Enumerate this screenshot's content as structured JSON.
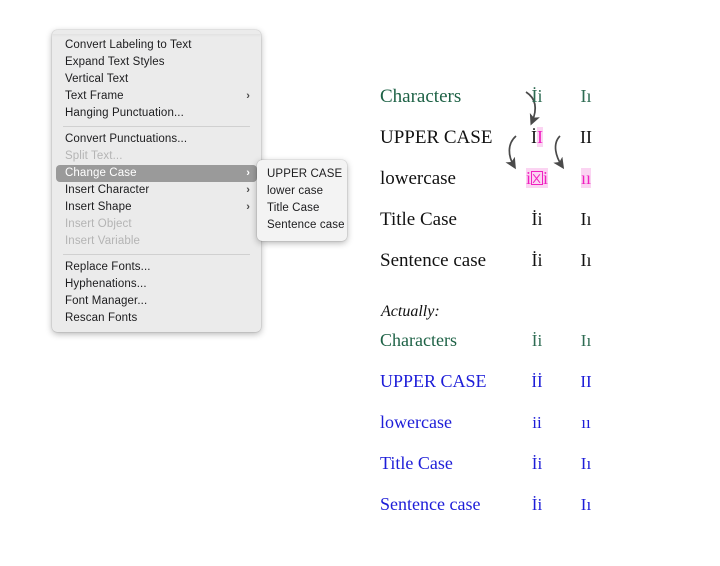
{
  "context_menu": {
    "name": "Text menu",
    "items": [
      {
        "label": "Convert Labeling to Text",
        "state": "normal",
        "submenu": false
      },
      {
        "label": "Expand Text Styles",
        "state": "normal",
        "submenu": false
      },
      {
        "label": "Vertical Text",
        "state": "normal",
        "submenu": false
      },
      {
        "label": "Text Frame",
        "state": "normal",
        "submenu": true
      },
      {
        "label": "Hanging Punctuation...",
        "state": "normal",
        "submenu": false
      },
      {
        "label": "",
        "state": "separator",
        "submenu": false
      },
      {
        "label": "Convert Punctuations...",
        "state": "normal",
        "submenu": false
      },
      {
        "label": "Split Text...",
        "state": "disabled",
        "submenu": false
      },
      {
        "label": "Change Case",
        "state": "highlighted",
        "submenu": true
      },
      {
        "label": "Insert Character",
        "state": "normal",
        "submenu": true
      },
      {
        "label": "Insert Shape",
        "state": "normal",
        "submenu": true
      },
      {
        "label": "Insert Object",
        "state": "disabled",
        "submenu": false
      },
      {
        "label": "Insert Variable",
        "state": "disabled",
        "submenu": false
      },
      {
        "label": "",
        "state": "separator",
        "submenu": false
      },
      {
        "label": "Replace Fonts...",
        "state": "normal",
        "submenu": false
      },
      {
        "label": "Hyphenations...",
        "state": "normal",
        "submenu": false
      },
      {
        "label": "Font Manager...",
        "state": "normal",
        "submenu": false
      },
      {
        "label": "Rescan Fonts",
        "state": "normal",
        "submenu": false
      }
    ],
    "submenu_arrow_glyph": "›"
  },
  "change_case_submenu": {
    "name": "Change Case",
    "items": [
      {
        "label": "UPPER CASE"
      },
      {
        "label": "lower case"
      },
      {
        "label": "Title Case"
      },
      {
        "label": "Sentence case"
      }
    ]
  },
  "colors": {
    "green": "#1e6246",
    "blue": "#1d1dd8",
    "magenta": "#f020c0",
    "highlight_pink": "#fbd4f2",
    "menu_bg": "#ebebeb",
    "menu_highlight": "#9a9a9a"
  },
  "top_table": {
    "rows": [
      {
        "label": "Characters",
        "label_color": "green",
        "col1": "İi",
        "col2": "Iı",
        "char_color": "green"
      },
      {
        "label": "UPPER CASE",
        "label_color": "black",
        "col1": "İI",
        "col2": "II",
        "char_color": "mixed"
      },
      {
        "label": "lowercase",
        "label_color": "black",
        "col1": "i■i",
        "col2": "ıı",
        "char_color": "magenta"
      },
      {
        "label": "Title Case",
        "label_color": "black",
        "col1": "İi",
        "col2": "Iı",
        "char_color": "black"
      },
      {
        "label": "Sentence case",
        "label_color": "black",
        "col1": "İi",
        "col2": "Iı",
        "char_color": "black"
      }
    ]
  },
  "actually_label": "Actually:",
  "bottom_table": {
    "rows": [
      {
        "label": "Characters",
        "label_color": "green",
        "col1": "İi",
        "col2": "Iı",
        "char_color": "green"
      },
      {
        "label": "UPPER CASE",
        "label_color": "blue",
        "col1": "İİ",
        "col2": "II",
        "char_color": "blue"
      },
      {
        "label": "lowercase",
        "label_color": "blue",
        "col1": "ii",
        "col2": "ıı",
        "char_color": "blue"
      },
      {
        "label": "Title Case",
        "label_color": "blue",
        "col1": "İi",
        "col2": "Iı",
        "char_color": "blue"
      },
      {
        "label": "Sentence case",
        "label_color": "blue",
        "col1": "İi",
        "col2": "Iı",
        "char_color": "blue"
      }
    ]
  }
}
